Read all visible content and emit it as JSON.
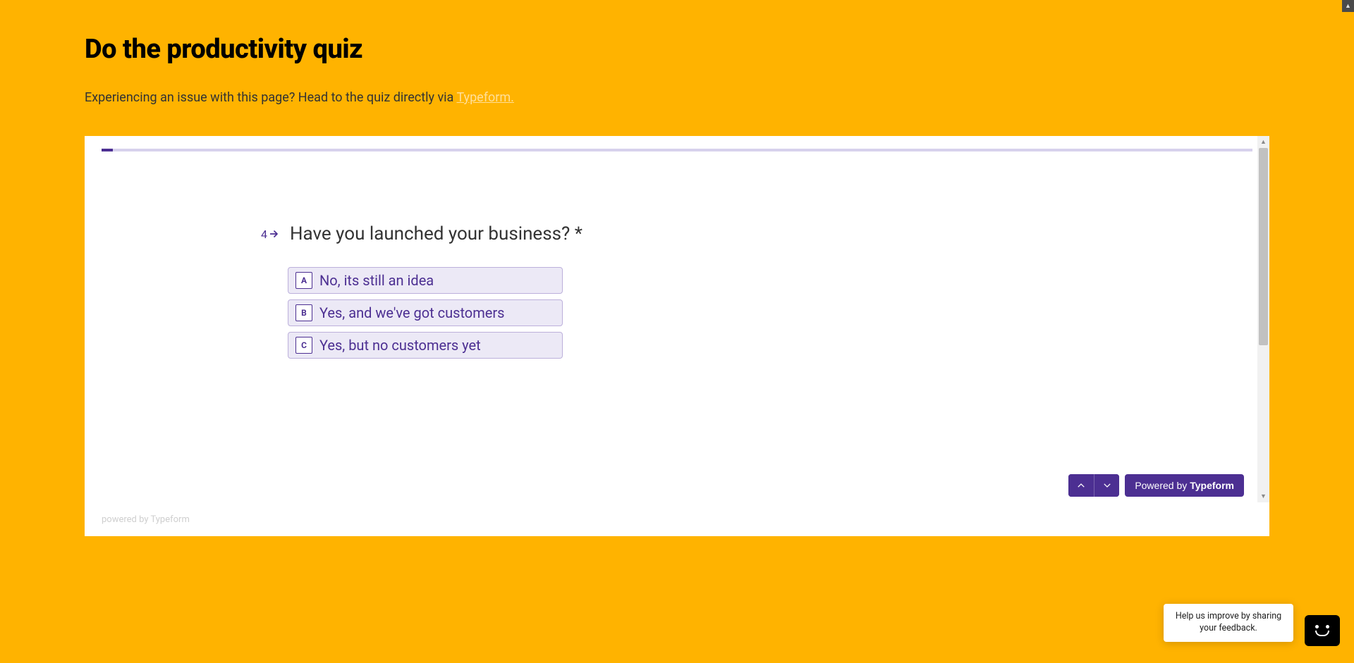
{
  "header": {
    "title": "Do the productivity quiz",
    "issue_prefix": "Experiencing an issue with this page? Head to the quiz directly via ",
    "issue_link_text": "Typeform."
  },
  "question": {
    "number": "4",
    "text": "Have you launched your business? *"
  },
  "options": [
    {
      "key": "A",
      "label": "No, its still an idea"
    },
    {
      "key": "B",
      "label": "Yes, and we've got customers"
    },
    {
      "key": "C",
      "label": "Yes, but no customers yet"
    }
  ],
  "nav": {
    "powered_prefix": "Powered by ",
    "powered_brand": "Typeform"
  },
  "footer": {
    "powered_text": "powered by Typeform"
  },
  "feedback": {
    "text": "Help us improve by sharing your feedback."
  },
  "colors": {
    "page_bg": "#ffb300",
    "accent": "#4c2f92",
    "option_bg": "#ece9f6"
  }
}
